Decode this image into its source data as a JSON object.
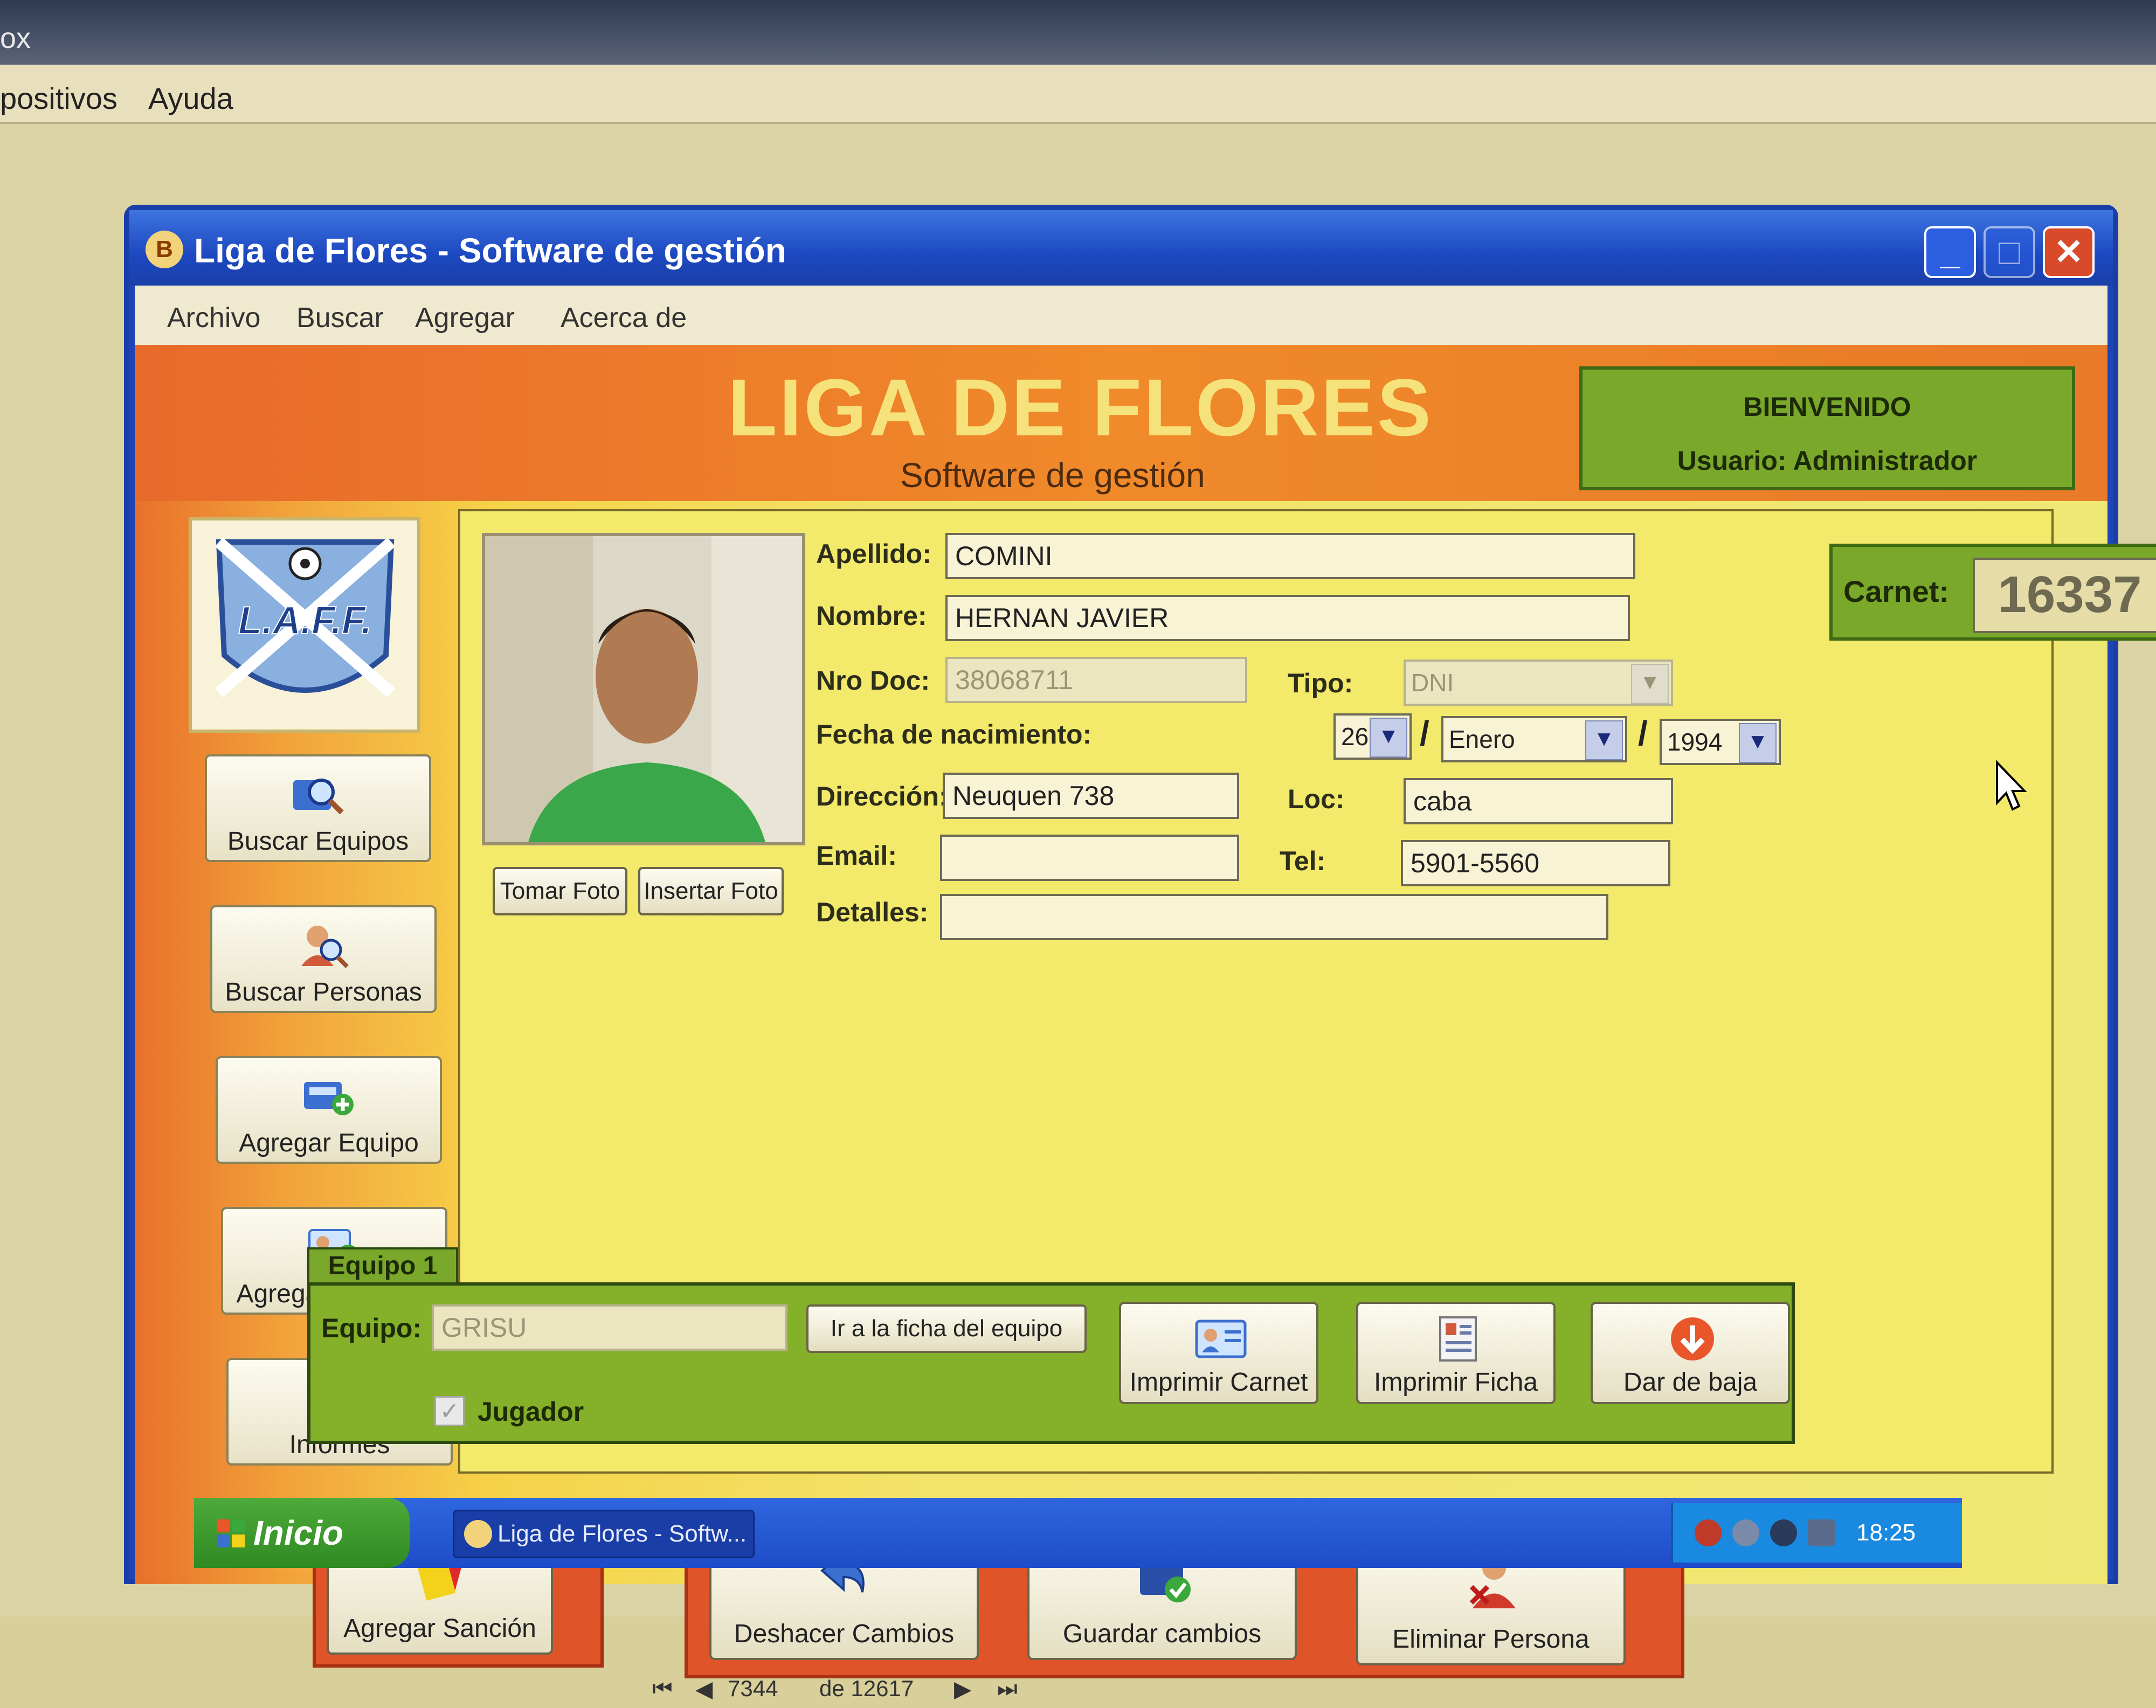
{
  "host": {
    "title_fragment": "ox",
    "menu": [
      "positivos",
      "Ayuda"
    ]
  },
  "window": {
    "title": "Liga de Flores - Software de gestión",
    "icon_text": "B",
    "controls": {
      "minimize": "_",
      "maximize": "□",
      "close": "✕"
    }
  },
  "menu": [
    "Archivo",
    "Buscar",
    "Agregar",
    "Acerca de"
  ],
  "header": {
    "title": "LIGA DE FLORES",
    "subtitle": "Software de gestión",
    "welcome_line1": "BIENVENIDO",
    "welcome_line2": "Usuario: Administrador"
  },
  "logo": {
    "text": "L.A.F.F."
  },
  "sidebar": [
    {
      "label": "Buscar Equipos",
      "icon": "search-teams-icon"
    },
    {
      "label": "Buscar Personas",
      "icon": "search-person-icon"
    },
    {
      "label": "Agregar Equipo",
      "icon": "add-team-icon"
    },
    {
      "label": "Agregar Persona",
      "icon": "add-person-icon"
    },
    {
      "label": "Informes",
      "icon": "report-icon"
    }
  ],
  "photo_buttons": {
    "take": "Tomar Foto",
    "insert": "Insertar Foto"
  },
  "form": {
    "apellido_label": "Apellido:",
    "apellido": "COMINI",
    "nombre_label": "Nombre:",
    "nombre": "HERNAN JAVIER",
    "doc_label": "Nro Doc:",
    "doc": "38068711",
    "tipo_label": "Tipo:",
    "tipo": "DNI",
    "fecha_label": "Fecha de nacimiento:",
    "dia": "26",
    "mes": "Enero",
    "anio": "1994",
    "separator": "/",
    "direccion_label": "Dirección:",
    "direccion": "Neuquen 738",
    "loc_label": "Loc:",
    "loc": "caba",
    "email_label": "Email:",
    "email": "",
    "tel_label": "Tel:",
    "tel": "5901-5560",
    "detalles_label": "Detalles:",
    "detalles": ""
  },
  "carnet": {
    "label": "Carnet:",
    "value": "16337"
  },
  "equipo": {
    "tab": "Equipo 1",
    "label": "Equipo:",
    "value": "GRISU",
    "goto": "Ir a la ficha del equipo",
    "jugador_label": "Jugador",
    "jugador_checked": true,
    "actions": [
      {
        "label": "Imprimir Carnet",
        "icon": "id-card-icon"
      },
      {
        "label": "Imprimir Ficha",
        "icon": "form-sheet-icon"
      },
      {
        "label": "Dar de baja",
        "icon": "down-arrow-icon"
      }
    ]
  },
  "bottom": {
    "sancion": "Agregar Sanción",
    "deshacer": "Deshacer Cambios",
    "guardar": "Guardar cambios",
    "eliminar": "Eliminar Persona"
  },
  "navigator": {
    "first": "⏮",
    "prev": "◀",
    "current": "7344",
    "of": "de 12617",
    "next": "▶",
    "last": "⏭"
  },
  "taskbar": {
    "start": "Inicio",
    "item": "Liga de Flores - Softw...",
    "clock": "18:25"
  },
  "colors": {
    "titlebar": "#1c48c0",
    "orange": "#e8702a",
    "yellow": "#f3e96a",
    "green": "#7aa82a",
    "red_panel": "#e0542a"
  }
}
